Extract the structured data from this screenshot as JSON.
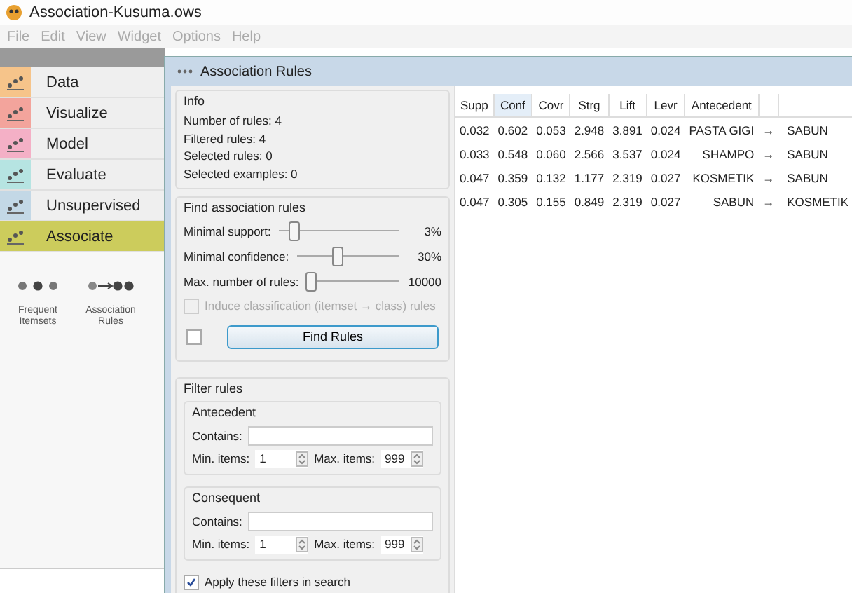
{
  "window": {
    "title": "Association-Kusuma.ows"
  },
  "menu": [
    "File",
    "Edit",
    "View",
    "Widget",
    "Options",
    "Help"
  ],
  "categories": [
    {
      "label": "Data",
      "color": "#f6c48a",
      "selected": false
    },
    {
      "label": "Visualize",
      "color": "#f3a49c",
      "selected": false
    },
    {
      "label": "Model",
      "color": "#f4b0c6",
      "selected": false
    },
    {
      "label": "Evaluate",
      "color": "#b6e4e2",
      "selected": false
    },
    {
      "label": "Unsupervised",
      "color": "#c3d8e6",
      "selected": false
    },
    {
      "label": "Associate",
      "color": "#cccc5c",
      "selected": true
    }
  ],
  "widgets": [
    {
      "kind": "itemsets",
      "label": "Frequent Itemsets"
    },
    {
      "kind": "rules",
      "label": "Association Rules"
    }
  ],
  "dialog": {
    "title": "Association Rules",
    "info": {
      "title": "Info",
      "lines": [
        "Number of rules: 4",
        "Filtered rules: 4",
        "Selected rules: 0",
        "Selected examples: 0"
      ]
    },
    "find": {
      "title": "Find association rules",
      "sliders": [
        {
          "label": "Minimal support:",
          "level": 0.12,
          "reading": "3%"
        },
        {
          "label": "Minimal confidence:",
          "level": 0.4,
          "reading": "30%"
        },
        {
          "label": "Max. number of rules:",
          "level": 0.04,
          "reading": "10000"
        }
      ],
      "induce": {
        "label": "Induce classification (itemset → class) rules",
        "checked": false,
        "disabled": true
      },
      "auto": {
        "checked": false
      },
      "button": "Find Rules"
    },
    "filter": {
      "title": "Filter rules",
      "groups": [
        {
          "title": "Antecedent",
          "contains_label": "Contains:",
          "min_label": "Min. items:",
          "min": "1",
          "max_label": "Max. items:",
          "max": "999"
        },
        {
          "title": "Consequent",
          "contains_label": "Contains:",
          "min_label": "Min. items:",
          "min": "1",
          "max_label": "Max. items:",
          "max": "999"
        }
      ],
      "apply": {
        "label": "Apply these filters in search",
        "checked": true
      }
    },
    "table": {
      "columns": [
        {
          "label": "Supp",
          "sorted": false
        },
        {
          "label": "Conf",
          "sorted": true
        },
        {
          "label": "Covr",
          "sorted": false
        },
        {
          "label": "Strg",
          "sorted": false
        },
        {
          "label": "Lift",
          "sorted": false
        },
        {
          "label": "Levr",
          "sorted": false
        },
        {
          "label": "Antecedent",
          "sorted": false
        }
      ],
      "rows": [
        {
          "values": [
            "0.032",
            "0.602",
            "0.053",
            "2.948",
            "3.891",
            "0.024"
          ],
          "antecedent": "PASTA GIGI",
          "arrow": "→",
          "consequent": "SABUN"
        },
        {
          "values": [
            "0.033",
            "0.548",
            "0.060",
            "2.566",
            "3.537",
            "0.024"
          ],
          "antecedent": "SHAMPO",
          "arrow": "→",
          "consequent": "SABUN"
        },
        {
          "values": [
            "0.047",
            "0.359",
            "0.132",
            "1.177",
            "2.319",
            "0.027"
          ],
          "antecedent": "KOSMETIK",
          "arrow": "→",
          "consequent": "SABUN"
        },
        {
          "values": [
            "0.047",
            "0.305",
            "0.155",
            "0.849",
            "2.319",
            "0.027"
          ],
          "antecedent": "SABUN",
          "arrow": "→",
          "consequent": "KOSMETIK"
        }
      ]
    }
  }
}
